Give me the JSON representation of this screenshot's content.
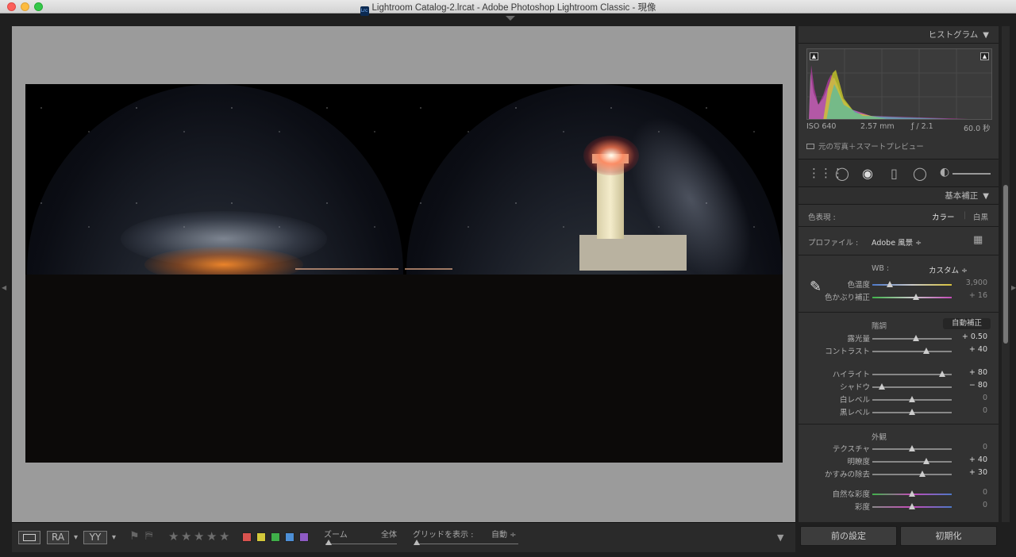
{
  "window": {
    "title": "Lightroom Catalog-2.lrcat - Adobe Photoshop Lightroom Classic - 現像",
    "app_icon": "Lrc"
  },
  "histogram": {
    "header": "ヒストグラム",
    "iso": "ISO 640",
    "focal": "2.57 mm",
    "aperture": "ƒ / 2.1",
    "shutter": "60.0 秒",
    "original_label": "元の写真＋スマートプレビュー"
  },
  "basic": {
    "header": "基本補正",
    "treatment_label": "色表現 :",
    "treatment_color": "カラー",
    "treatment_bw": "白黒",
    "profile_label": "プロファイル :",
    "profile_value": "Adobe 風景 ÷",
    "wb_label": "WB :",
    "wb_value": "カスタム ÷",
    "tone_label": "階調",
    "auto_label": "自動補正",
    "presence_label": "外観",
    "sliders": [
      {
        "label": "色温度",
        "value": "3,900",
        "pos": 0.22,
        "dim": true
      },
      {
        "label": "色かぶり補正",
        "value": "+ 16",
        "pos": 0.55,
        "dim": true
      },
      {
        "label": "露光量",
        "value": "+ 0.50",
        "pos": 0.55,
        "dim": false
      },
      {
        "label": "コントラスト",
        "value": "+ 40",
        "pos": 0.68,
        "dim": false
      },
      {
        "label": "ハイライト",
        "value": "+ 80",
        "pos": 0.88,
        "dim": false
      },
      {
        "label": "シャドウ",
        "value": "− 80",
        "pos": 0.12,
        "dim": false
      },
      {
        "label": "白レベル",
        "value": "0",
        "pos": 0.5,
        "dim": true
      },
      {
        "label": "黒レベル",
        "value": "0",
        "pos": 0.5,
        "dim": true
      },
      {
        "label": "テクスチャ",
        "value": "0",
        "pos": 0.5,
        "dim": true
      },
      {
        "label": "明瞭度",
        "value": "+ 40",
        "pos": 0.68,
        "dim": false
      },
      {
        "label": "かすみの除去",
        "value": "+ 30",
        "pos": 0.63,
        "dim": false
      },
      {
        "label": "自然な彩度",
        "value": "0",
        "pos": 0.5,
        "dim": true
      },
      {
        "label": "彩度",
        "value": "0",
        "pos": 0.5,
        "dim": true
      }
    ]
  },
  "toolbar": {
    "zoom_label": "ズーム",
    "zoom_value": "全体",
    "grid_label": "グリッドを表示 :",
    "grid_value": "自動 ÷",
    "compare_1": "RA",
    "compare_2": "YY",
    "label_colors": [
      "#d9534f",
      "#d4c93b",
      "#3fae49",
      "#4d8fd6",
      "#8e5bc4"
    ],
    "rating": 0
  },
  "panel_buttons": {
    "previous": "前の設定",
    "reset": "初期化"
  }
}
